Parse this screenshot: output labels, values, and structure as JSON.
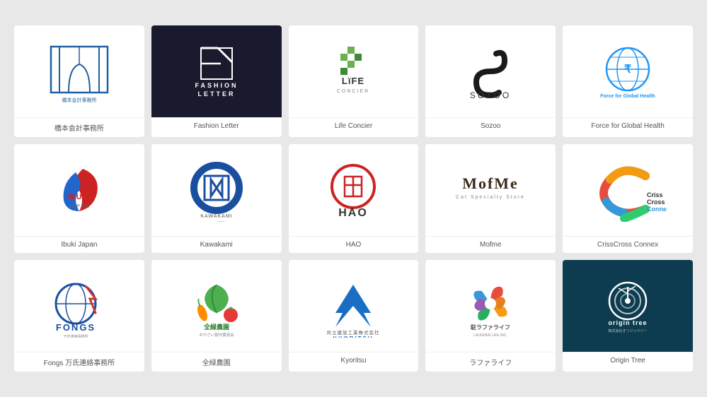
{
  "logos": [
    {
      "id": "hashimoto",
      "label": "橋本会計事務所",
      "bg": "white"
    },
    {
      "id": "fashion-letter",
      "label": "Fashion Letter",
      "bg": "dark"
    },
    {
      "id": "life-concier",
      "label": "Life Concier",
      "bg": "white"
    },
    {
      "id": "sozoo",
      "label": "Sozoo",
      "bg": "white"
    },
    {
      "id": "force-global-health",
      "label": "Force for Global Health",
      "bg": "white"
    },
    {
      "id": "ibuki-japan",
      "label": "Ibuki Japan",
      "bg": "white"
    },
    {
      "id": "kawakami",
      "label": "Kawakami",
      "bg": "white"
    },
    {
      "id": "hao",
      "label": "HAO",
      "bg": "white"
    },
    {
      "id": "mofme",
      "label": "Mofme",
      "bg": "white"
    },
    {
      "id": "crisscross-connex",
      "label": "CrissCross Connex",
      "bg": "white"
    },
    {
      "id": "fongs",
      "label": "Fongs 万氏連絡事務所",
      "bg": "white"
    },
    {
      "id": "zenroku-nouen",
      "label": "全緑農園",
      "bg": "white"
    },
    {
      "id": "kyoritsu",
      "label": "Kyoritsu",
      "bg": "white"
    },
    {
      "id": "laugher-life",
      "label": "ラファライフ",
      "bg": "white"
    },
    {
      "id": "origin-tree",
      "label": "Origin Tree",
      "bg": "teal"
    }
  ]
}
